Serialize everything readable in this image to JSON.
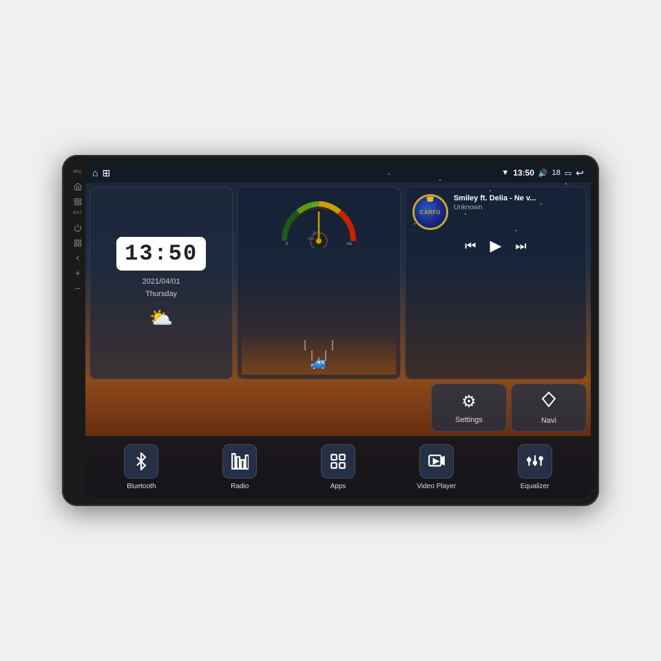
{
  "device": {
    "bezel_labels": {
      "mic": "MIC",
      "rst": "RST"
    }
  },
  "status_bar": {
    "wifi_icon": "▼",
    "time": "13:50",
    "volume_icon": "🔊",
    "volume_level": "18",
    "window_icon": "▭",
    "back_icon": "↩",
    "home_icon": "⌂",
    "apps_icon": "⊞"
  },
  "clock_widget": {
    "time": "13:50",
    "date_line1": "2021/04/01",
    "date_line2": "Thursday",
    "weather_icon": "⛅"
  },
  "speedometer": {
    "speed_unit": "km/h",
    "current_speed": "0"
  },
  "music_widget": {
    "title": "Smiley ft. Delia - Ne v...",
    "artist": "Unknown",
    "album_label": "CARFU",
    "prev_icon": "⏮",
    "play_icon": "▶",
    "next_icon": "⏭"
  },
  "action_buttons": [
    {
      "id": "settings",
      "icon": "⚙",
      "label": "Settings"
    },
    {
      "id": "navi",
      "icon": "▲",
      "label": "Navi"
    }
  ],
  "bottom_bar": [
    {
      "id": "bluetooth",
      "icon": "bluetooth",
      "label": "Bluetooth"
    },
    {
      "id": "radio",
      "icon": "radio",
      "label": "Radio"
    },
    {
      "id": "apps",
      "icon": "apps",
      "label": "Apps"
    },
    {
      "id": "video",
      "icon": "video",
      "label": "Video Player"
    },
    {
      "id": "equalizer",
      "icon": "equalizer",
      "label": "Equalizer"
    }
  ],
  "side_buttons": [
    {
      "id": "home",
      "icon": "home"
    },
    {
      "id": "apps2",
      "icon": "square"
    },
    {
      "id": "back",
      "icon": "back"
    },
    {
      "id": "vol-up",
      "icon": "plus"
    },
    {
      "id": "vol-down",
      "icon": "minus"
    }
  ]
}
